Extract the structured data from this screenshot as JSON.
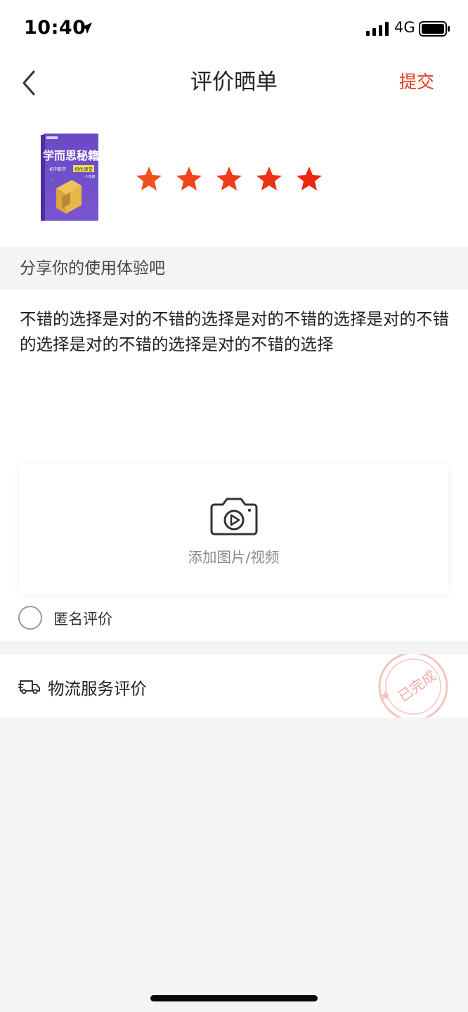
{
  "status_bar": {
    "time": "10:40",
    "network": "4G"
  },
  "nav": {
    "title": "评价晒单",
    "submit_label": "提交",
    "back_icon": "chevron-left-icon"
  },
  "product": {
    "cover_text": {
      "brand": "学而思秘籍",
      "subtitle": "初中数学",
      "badge": "培优课堂",
      "grade": "八年级"
    },
    "rating": {
      "value": 5,
      "max": 5,
      "star_colors": [
        "#f24f1f",
        "#f2441c",
        "#f03a18",
        "#ee2f14",
        "#ec2410"
      ]
    }
  },
  "review": {
    "prompt": "分享你的使用体验吧",
    "text": "不错的选择是对的不错的选择是对的不错的选择是对的不错的选择是对的不错的选择是对的不错的选择",
    "upload_label": "添加图片/视频",
    "anonymous_label": "匿名评价",
    "anonymous_checked": false
  },
  "logistics": {
    "label": "物流服务评价",
    "stamp_text": "已完成"
  },
  "colors": {
    "accent": "#e8391e",
    "background": "#f4f4f4"
  }
}
